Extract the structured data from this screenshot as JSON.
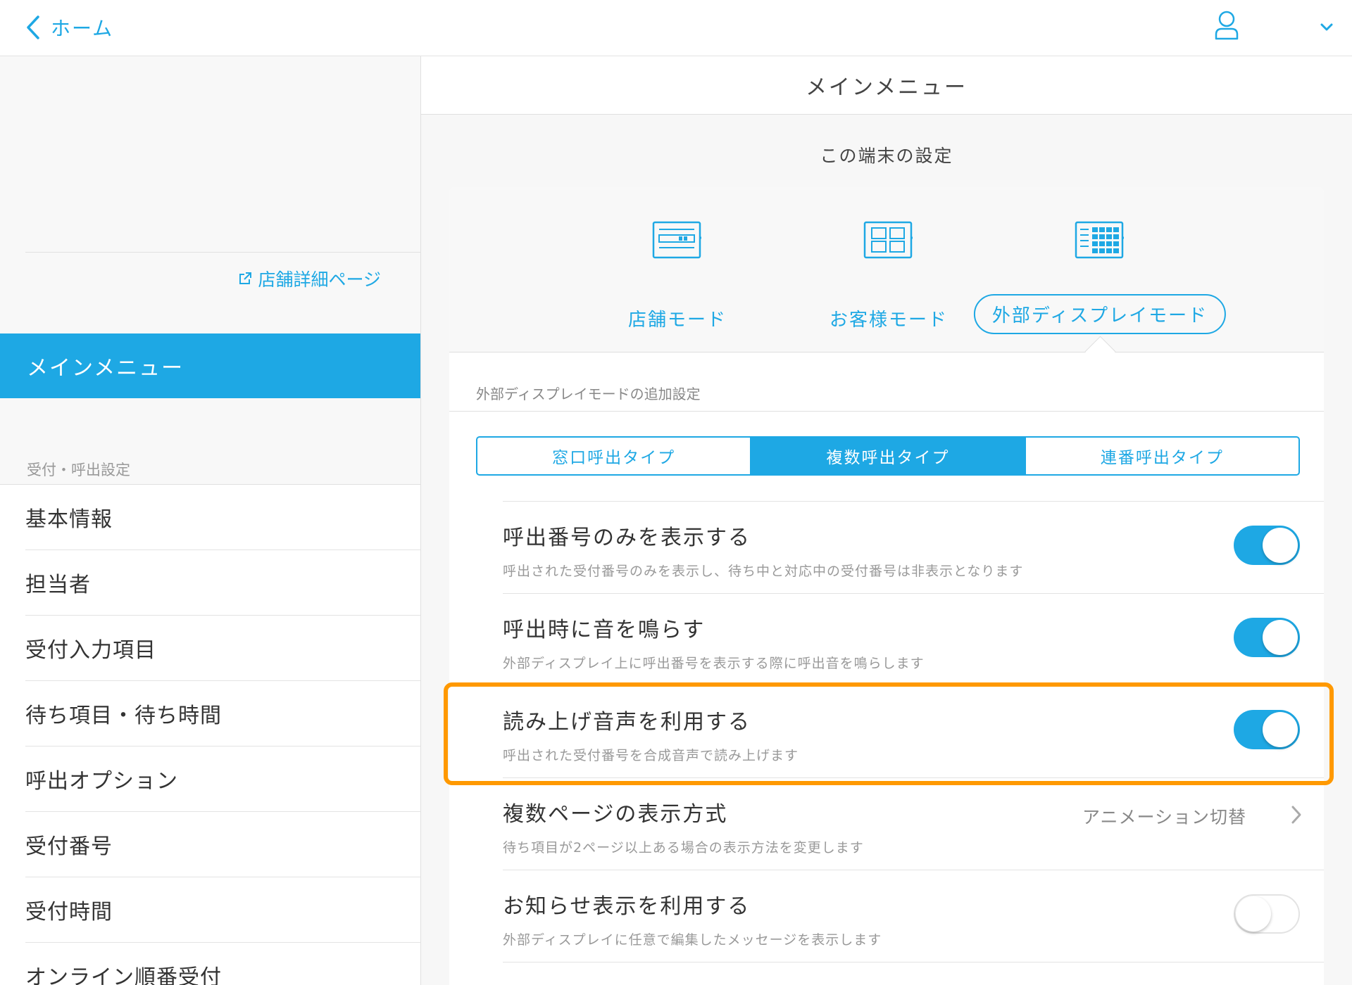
{
  "topbar": {
    "back_label": "ホーム"
  },
  "sidebar": {
    "store_link": "店舗詳細ページ",
    "active_item": "メインメニュー",
    "section_label": "受付・呼出設定",
    "items": [
      {
        "label": "基本情報"
      },
      {
        "label": "担当者"
      },
      {
        "label": "受付入力項目"
      },
      {
        "label": "待ち項目・待ち時間"
      },
      {
        "label": "呼出オプション"
      },
      {
        "label": "受付番号"
      },
      {
        "label": "受付時間"
      },
      {
        "label": "オンライン順番受付"
      }
    ]
  },
  "main": {
    "header": "メインメニュー",
    "device_title": "この端末の設定",
    "modes": [
      {
        "label": "店舗モード",
        "icon": "store-mode-icon"
      },
      {
        "label": "お客様モード",
        "icon": "customer-mode-icon"
      },
      {
        "label": "外部ディスプレイモード",
        "icon": "external-display-mode-icon",
        "selected": true
      }
    ],
    "sub_heading": "外部ディスプレイモードの追加設定",
    "segments": [
      {
        "label": "窓口呼出タイプ"
      },
      {
        "label": "複数呼出タイプ",
        "active": true
      },
      {
        "label": "連番呼出タイプ"
      }
    ],
    "rows": [
      {
        "title": "呼出番号のみを表示する",
        "desc": "呼出された受付番号のみを表示し、待ち中と対応中の受付番号は非表示となります",
        "toggle": true
      },
      {
        "title": "呼出時に音を鳴らす",
        "desc": "外部ディスプレイ上に呼出番号を表示する際に呼出音を鳴らします",
        "toggle": true
      },
      {
        "title": "読み上げ音声を利用する",
        "desc": "呼出された受付番号を合成音声で読み上げます",
        "toggle": true
      },
      {
        "title": "複数ページの表示方式",
        "desc": "待ち項目が2ページ以上ある場合の表示方法を変更します",
        "value": "アニメーション切替"
      },
      {
        "title": "お知らせ表示を利用する",
        "desc": "外部ディスプレイに任意で編集したメッセージを表示します",
        "toggle": false
      }
    ]
  },
  "colors": {
    "accent": "#1ea8e4",
    "highlight": "#ff9900"
  }
}
